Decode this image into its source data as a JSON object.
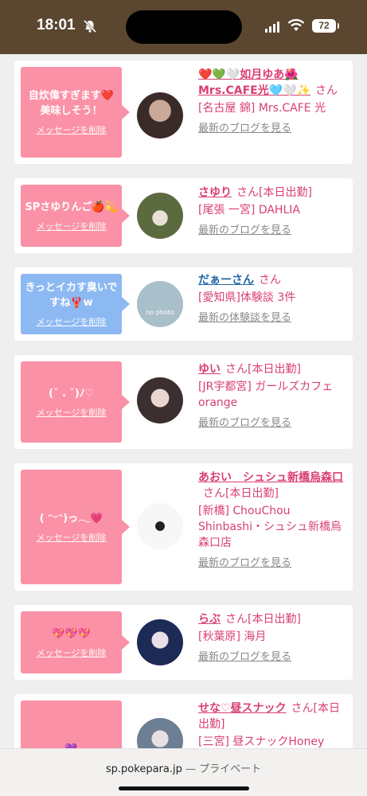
{
  "status": {
    "time": "18:01",
    "battery": "72"
  },
  "delete_label": "メッセージを削除",
  "cards": [
    {
      "bubble": "自炊偉すぎます❤️美味しそう！",
      "name": "❤️💚🤍如月ゆあ🌺Mrs.CAFE光🩵🤍✨",
      "suffix": "さん",
      "detail": "[名古屋 錦] Mrs.CAFE 光",
      "more": "最新のブログを見る"
    },
    {
      "bubble": "SPさゆりんご🍎💫",
      "name": "さゆり",
      "suffix": "さん[本日出勤]",
      "detail": "[尾張 一宮] DAHLIA",
      "more": "最新のブログを見る"
    },
    {
      "bubble": "きっとイカす臭いですね🦞w",
      "name": "だぁーさん",
      "suffix": "さん",
      "detail": "[愛知県]体験談 3件",
      "more": "最新の体験談を見る",
      "avatar_text": "no photo"
    },
    {
      "bubble": "(˘ . ˘)ﾉ♡",
      "name": "ゆい",
      "suffix": "さん[本日出勤]",
      "detail": "[JR宇都宮] ガールズカフェorange",
      "more": "最新のブログを見る"
    },
    {
      "bubble": "( ᵔᵕᵔ)っ𓂃💗",
      "name": "あおい　シュシュ新橋烏森口",
      "suffix": "さん[本日出勤]",
      "detail": "[新橋] ChouChou Shinbashi・シュシュ新橋烏森口店",
      "more": "最新のブログを見る"
    },
    {
      "bubble": "💖💖💖",
      "name": "らぶ",
      "suffix": "さん[本日出勤]",
      "detail": "[秋葉原] 海月",
      "more": "最新のブログを見る"
    },
    {
      "bubble": "💜",
      "name": "せな♡昼スナック",
      "suffix": "さん[本日出勤]",
      "detail": "[三宮] 昼スナックHoney",
      "more": ""
    }
  ],
  "footer": {
    "domain": "sp.pokepara.jp",
    "privacy": " — プライベート"
  },
  "colors": {
    "accent": "#d93f71",
    "bubble_pink": "#fb91a6",
    "bubble_blue": "#8db9f3",
    "status_bg": "#5b4630"
  }
}
